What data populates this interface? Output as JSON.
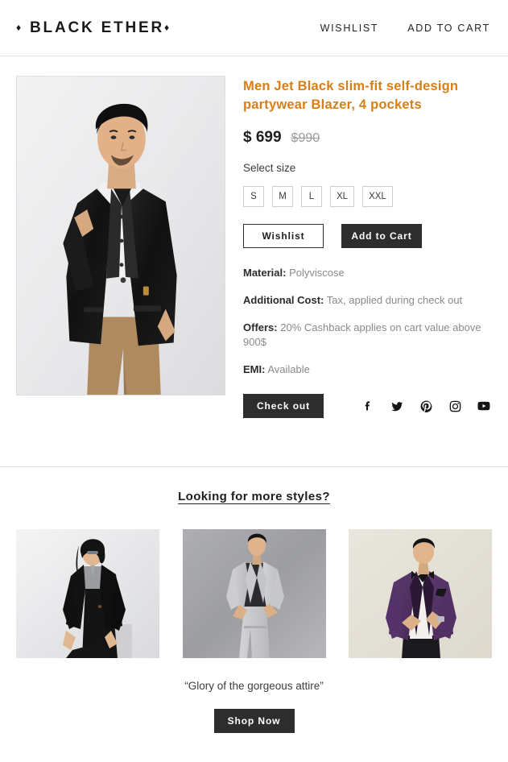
{
  "header": {
    "brand": "BLACK ETHER",
    "brand_diamond": "♦",
    "nav": [
      {
        "label": "WISHLIST",
        "name": "nav-wishlist"
      },
      {
        "label": "ADD TO CART",
        "name": "nav-add-to-cart"
      }
    ]
  },
  "product": {
    "title": "Men Jet Black slim-fit self-design partywear Blazer, 4 pockets",
    "price_current": "$ 699",
    "price_original": "$990",
    "size_label": "Select size",
    "sizes": [
      "S",
      "M",
      "L",
      "XL",
      "XXL"
    ],
    "wishlist_button": "Wishlist",
    "add_to_cart_button": "Add to Cart",
    "checkout_button": "Check out",
    "details": [
      {
        "label": "Material:",
        "value": "Polyviscose"
      },
      {
        "label": "Additional Cost:",
        "value": "Tax, applied during check out"
      },
      {
        "label": "Offers:",
        "value": "20% Cashback applies on cart value above 900$"
      },
      {
        "label": "EMI:",
        "value": "Available"
      }
    ],
    "main_image_alt": "Man wearing black self-design partywear blazer with tan trousers"
  },
  "social": [
    {
      "name": "facebook-icon",
      "label": "Facebook"
    },
    {
      "name": "twitter-icon",
      "label": "Twitter"
    },
    {
      "name": "pinterest-icon",
      "label": "Pinterest"
    },
    {
      "name": "instagram-icon",
      "label": "Instagram"
    },
    {
      "name": "youtube-icon",
      "label": "YouTube"
    }
  ],
  "styles_section": {
    "heading": "Looking for more styles?",
    "thumbnails": [
      {
        "name": "thumbnail-black-jacket",
        "alt": "Woman in black jacket"
      },
      {
        "name": "thumbnail-grey-suit",
        "alt": "Man in light grey suit"
      },
      {
        "name": "thumbnail-purple-tuxedo",
        "alt": "Man in purple tuxedo with bow tie"
      }
    ],
    "quote": "“Glory of the gorgeous attire”",
    "shop_now_button": "Shop Now"
  },
  "colors": {
    "accent_orange": "#d97e14",
    "dark_button": "#2d2d2d",
    "muted_text": "#8a8a8a",
    "border": "#e4e4e4"
  }
}
